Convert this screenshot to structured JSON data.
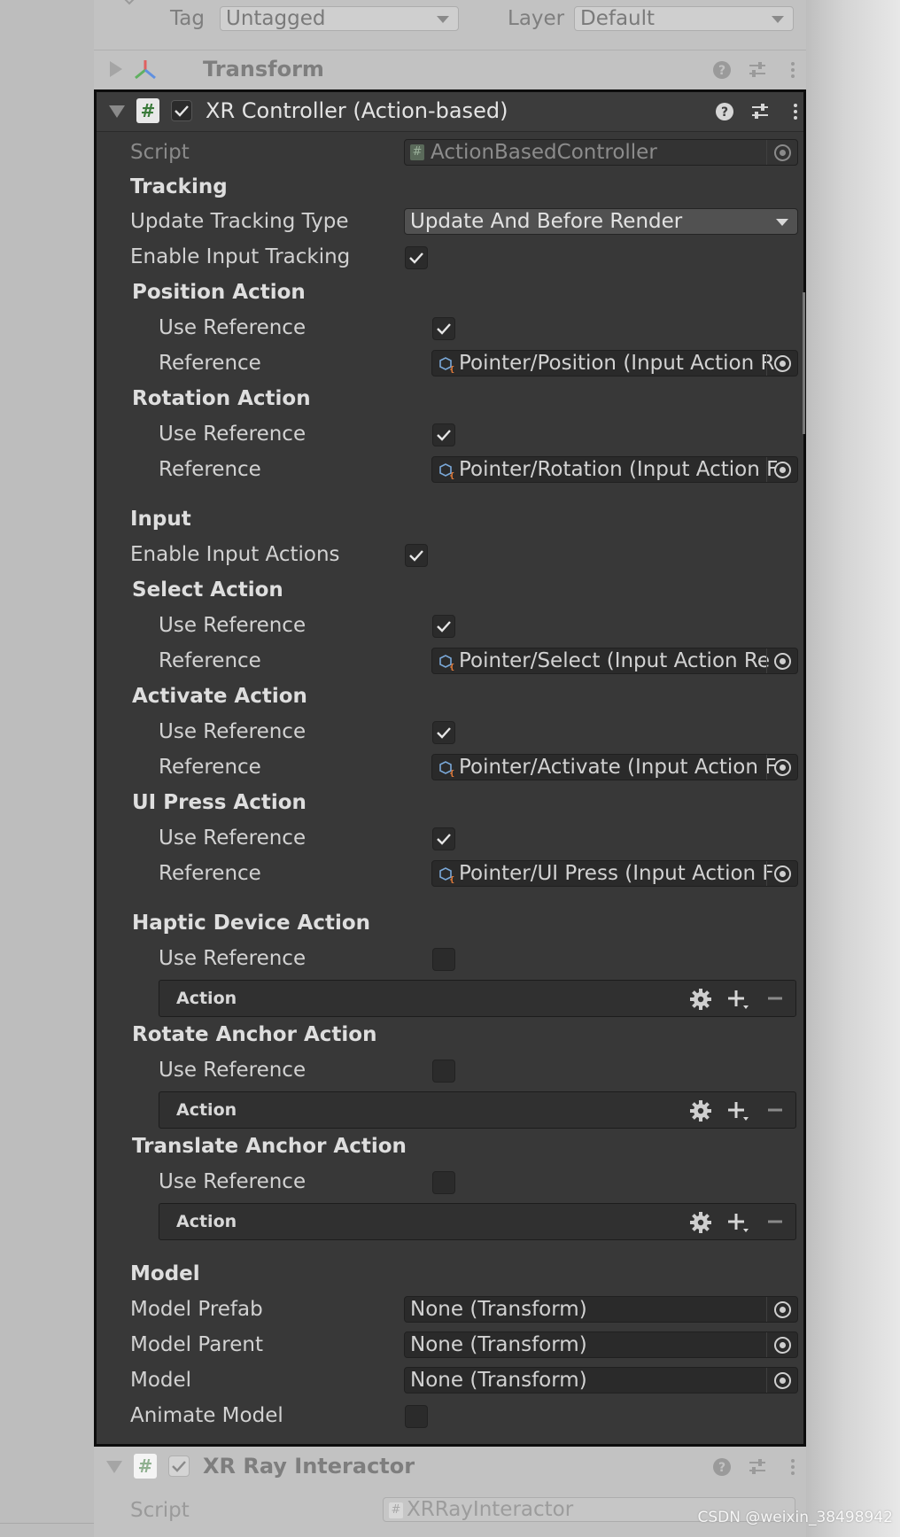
{
  "top": {
    "tag_label": "Tag",
    "tag_value": "Untagged",
    "layer_label": "Layer",
    "layer_value": "Default"
  },
  "transform": {
    "title": "Transform"
  },
  "component": {
    "title": "XR Controller (Action-based)",
    "script_label": "Script",
    "script_value": "ActionBasedController",
    "tracking_header": "Tracking",
    "update_tracking_type_label": "Update Tracking Type",
    "update_tracking_type_value": "Update And Before Render",
    "enable_input_tracking_label": "Enable Input Tracking",
    "position_action": {
      "header": "Position Action",
      "use_ref_label": "Use Reference",
      "ref_label": "Reference",
      "ref_value": "Pointer/Position (Input Action R"
    },
    "rotation_action": {
      "header": "Rotation Action",
      "use_ref_label": "Use Reference",
      "ref_label": "Reference",
      "ref_value": "Pointer/Rotation (Input Action F"
    },
    "input_header": "Input",
    "enable_input_actions_label": "Enable Input Actions",
    "select_action": {
      "header": "Select Action",
      "use_ref_label": "Use Reference",
      "ref_label": "Reference",
      "ref_value": "Pointer/Select (Input Action Re"
    },
    "activate_action": {
      "header": "Activate Action",
      "use_ref_label": "Use Reference",
      "ref_label": "Reference",
      "ref_value": "Pointer/Activate (Input Action F"
    },
    "ui_press_action": {
      "header": "UI Press Action",
      "use_ref_label": "Use Reference",
      "ref_label": "Reference",
      "ref_value": "Pointer/UI Press (Input Action F"
    },
    "haptic_device_action": {
      "header": "Haptic Device Action",
      "use_ref_label": "Use Reference",
      "action_label": "Action"
    },
    "rotate_anchor_action": {
      "header": "Rotate Anchor Action",
      "use_ref_label": "Use Reference",
      "action_label": "Action"
    },
    "translate_anchor_action": {
      "header": "Translate Anchor Action",
      "use_ref_label": "Use Reference",
      "action_label": "Action"
    },
    "model_header": "Model",
    "model_prefab_label": "Model Prefab",
    "model_prefab_value": "None (Transform)",
    "model_parent_label": "Model Parent",
    "model_parent_value": "None (Transform)",
    "model_label": "Model",
    "model_value": "None (Transform)",
    "animate_model_label": "Animate Model"
  },
  "ray_interactor": {
    "title": "XR Ray Interactor",
    "script_label": "Script",
    "script_value": "XRRayInteractor"
  },
  "watermark": "CSDN @weixin_38498942",
  "colors": {
    "inspector_bg": "#383838",
    "field_bg": "#2a2a2a",
    "dropdown_bg": "#515151",
    "text": "#d2d2d2",
    "script_icon_green": "#3a7a3a"
  }
}
